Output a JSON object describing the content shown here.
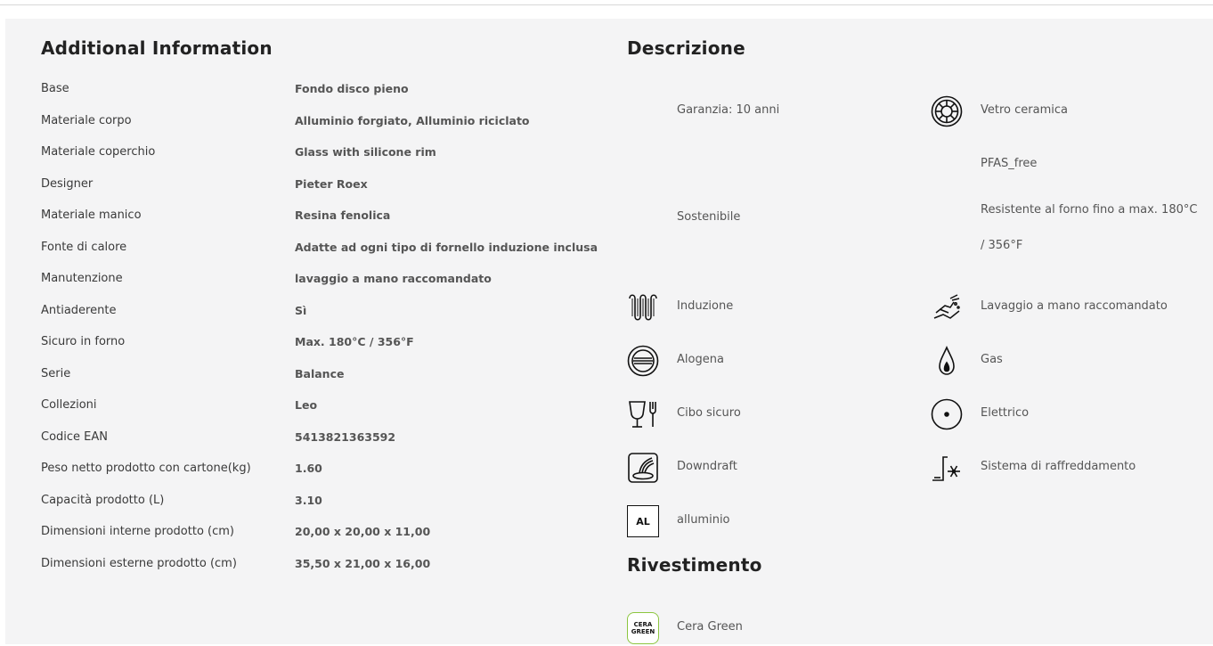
{
  "additional_info": {
    "title": "Additional Information",
    "rows": [
      {
        "label": "Base",
        "value": "Fondo disco pieno"
      },
      {
        "label": "Materiale corpo",
        "value": "Alluminio forgiato, Alluminio riciclato"
      },
      {
        "label": "Materiale coperchio",
        "value": "Glass with silicone rim"
      },
      {
        "label": "Designer",
        "value": "Pieter Roex"
      },
      {
        "label": "Materiale manico",
        "value": "Resina fenolica"
      },
      {
        "label": "Fonte di calore",
        "value": "Adatte ad ogni tipo di fornello induzione inclusa"
      },
      {
        "label": "Manutenzione",
        "value": "lavaggio a mano raccomandato"
      },
      {
        "label": "Antiaderente",
        "value": "Sì"
      },
      {
        "label": "Sicuro in forno",
        "value": "Max. 180°C / 356°F"
      },
      {
        "label": "Serie",
        "value": "Balance"
      },
      {
        "label": "Collezioni",
        "value": "Leo"
      },
      {
        "label": "Codice EAN",
        "value": "5413821363592"
      },
      {
        "label": "Peso netto prodotto con cartone(kg)",
        "value": "1.60"
      },
      {
        "label": "Capacità prodotto (L)",
        "value": "3.10"
      },
      {
        "label": "Dimensioni interne prodotto (cm)",
        "value": "20,00 x 20,00 x 11,00"
      },
      {
        "label": "Dimensioni esterne prodotto (cm)",
        "value": "35,50 x 21,00 x 16,00"
      }
    ]
  },
  "descrizione": {
    "title": "Descrizione",
    "features": [
      {
        "label": "Garanzia: 10 anni",
        "icon": "none"
      },
      {
        "label": "Vetro ceramica",
        "icon": "ceramic-glass-icon"
      },
      {
        "label": "PFAS_free",
        "icon": "none"
      },
      {
        "label": "Sostenibile",
        "icon": "none"
      },
      {
        "label": "Resistente al forno fino a max. 180°C / 356°F",
        "icon": "none"
      },
      {
        "label": "Induzione",
        "icon": "induction-icon"
      },
      {
        "label": "Lavaggio a mano raccomandato",
        "icon": "hand-wash-icon"
      },
      {
        "label": "Alogena",
        "icon": "halogen-icon"
      },
      {
        "label": "Gas",
        "icon": "gas-icon"
      },
      {
        "label": "Cibo sicuro",
        "icon": "food-safe-icon"
      },
      {
        "label": "Elettrico",
        "icon": "electric-icon"
      },
      {
        "label": "Downdraft",
        "icon": "downdraft-icon"
      },
      {
        "label": "Sistema di raffreddamento",
        "icon": "cooling-system-icon"
      },
      {
        "label": "alluminio",
        "icon": "aluminium-icon",
        "badge": "AL"
      }
    ]
  },
  "rivestimento": {
    "title": "Rivestimento",
    "items": [
      {
        "label": "Cera Green",
        "icon": "cera-green-icon",
        "badge_line1": "CERA",
        "badge_line2": "GREEN"
      }
    ]
  },
  "colors": {
    "panel_bg": "#f4f4f5",
    "text": "#333333",
    "cera_green": "#8cc63f"
  }
}
